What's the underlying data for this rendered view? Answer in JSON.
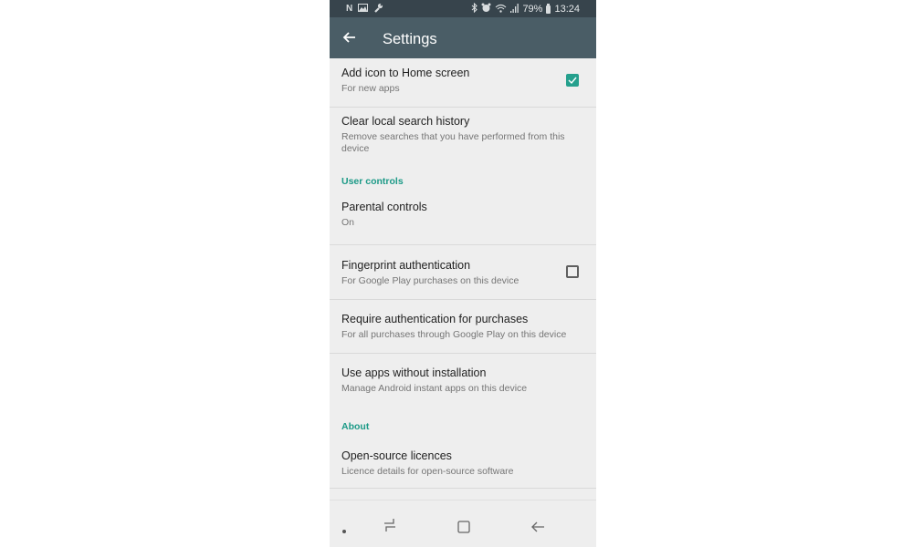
{
  "status_bar": {
    "left_icons": [
      "notification-n-icon",
      "image-icon",
      "wrench-icon"
    ],
    "right_icons": [
      "bluetooth-icon",
      "alarm-icon",
      "wifi-icon",
      "signal-icon"
    ],
    "battery": "79%",
    "time": "13:24"
  },
  "app_bar": {
    "title": "Settings",
    "back_icon": "arrow-left-icon"
  },
  "settings": {
    "add_icon": {
      "title": "Add icon to Home screen",
      "subtitle": "For new apps",
      "checked": true
    },
    "clear_history": {
      "title": "Clear local search history",
      "subtitle": "Remove searches that you have performed from this device"
    },
    "user_controls_header": "User controls",
    "parental": {
      "title": "Parental controls",
      "subtitle": "On"
    },
    "fingerprint": {
      "title": "Fingerprint authentication",
      "subtitle": "For Google Play purchases on this device",
      "checked": false
    },
    "require_auth": {
      "title": "Require authentication for purchases",
      "subtitle": "For all purchases through Google Play on this device"
    },
    "instant_apps": {
      "title": "Use apps without installation",
      "subtitle": "Manage Android instant apps on this device"
    },
    "about_header": "About",
    "licences": {
      "title": "Open-source licences",
      "subtitle": "Licence details for open-source software"
    }
  },
  "nav_bar": {
    "buttons": [
      "dot-icon",
      "recents-icon",
      "home-icon",
      "back-icon"
    ]
  },
  "colors": {
    "accent": "#1c9a87",
    "checkbox": "#25a08d",
    "app_bar": "#4a5d66",
    "status_bar": "#37444c",
    "background": "#eeeeee"
  }
}
